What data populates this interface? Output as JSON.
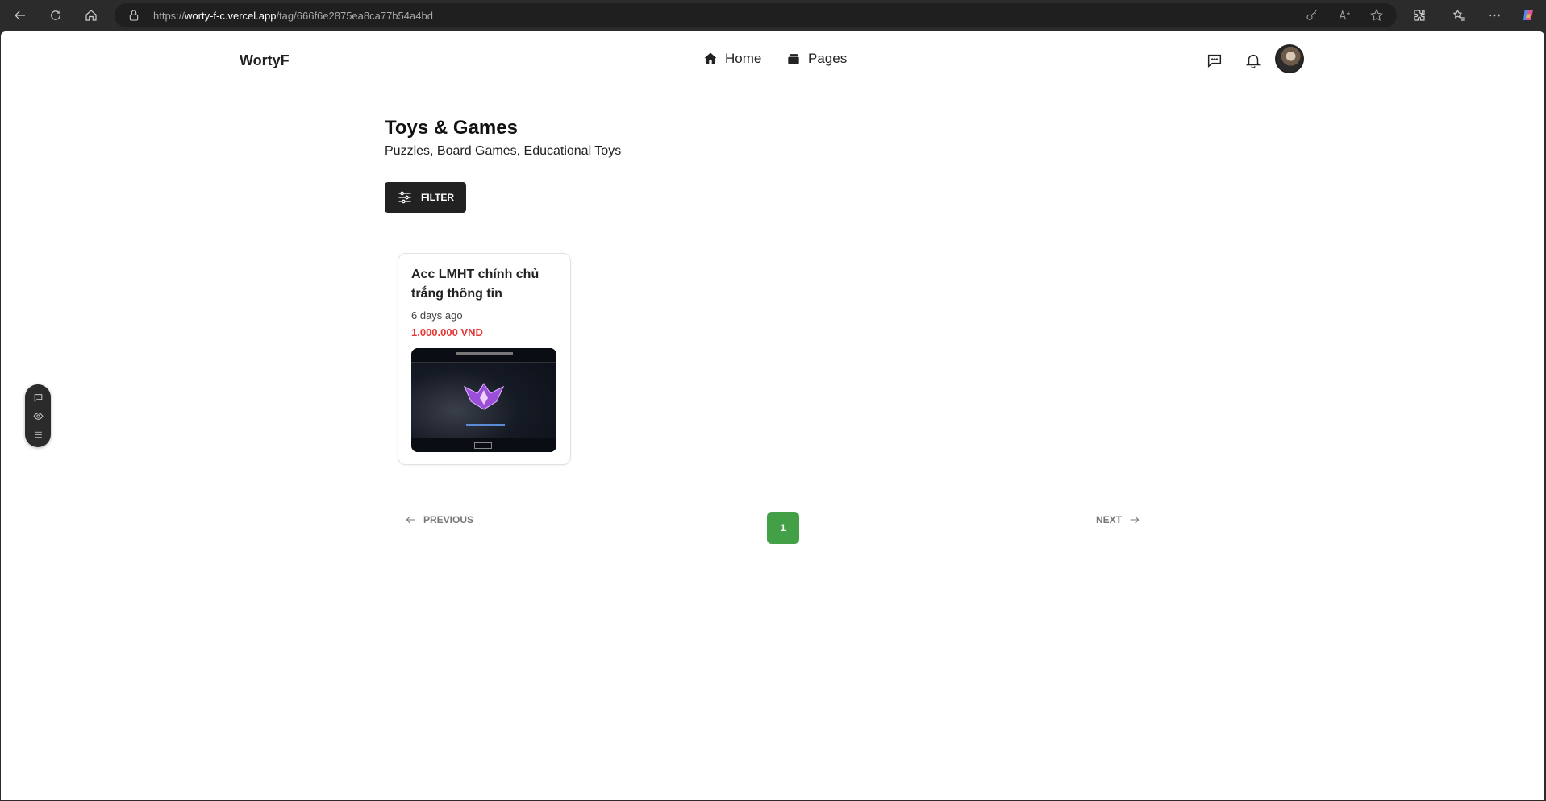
{
  "browser": {
    "url_prefix": "https://",
    "url_host": "worty-f-c.vercel.app",
    "url_path": "/tag/666f6e2875ea8ca77b54a4bd"
  },
  "header": {
    "brand": "WortyF",
    "nav": [
      {
        "label": "Home",
        "icon": "home-icon"
      },
      {
        "label": "Pages",
        "icon": "pages-icon"
      }
    ]
  },
  "main": {
    "title": "Toys & Games",
    "subtitle": "Puzzles, Board Games, Educational Toys",
    "filter_label": "FILTER"
  },
  "products": [
    {
      "title": "Acc LMHT chính chủ trắng thông tin",
      "time": "6 days ago",
      "price": "1.000.000 VND"
    }
  ],
  "pagination": {
    "previous": "PREVIOUS",
    "page": "1",
    "next": "NEXT"
  },
  "colors": {
    "accent_green": "#43a047",
    "price_red": "#e53935",
    "dark": "#222222"
  }
}
